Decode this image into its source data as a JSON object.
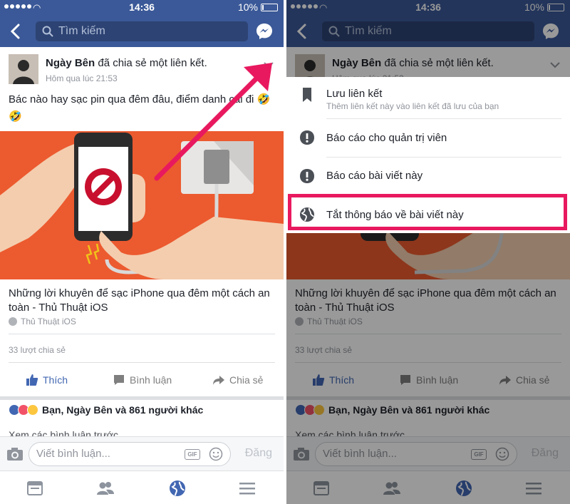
{
  "status": {
    "time": "14:36",
    "battery": "10%"
  },
  "search": {
    "placeholder": "Tìm kiếm"
  },
  "post": {
    "author": "Ngày Bên",
    "action": " đã chia sẻ một liên kết.",
    "time": "Hôm qua lúc 21:53",
    "text": "Bác nào hay sạc pin qua đêm đâu, điểm danh cái đi 🤣🤣",
    "link_title": "Những lời khuyên để sạc iPhone qua đêm một cách an toàn - Thủ Thuật iOS",
    "link_source": "Thủ Thuật iOS",
    "share_count": "33 lượt chia sẻ",
    "actions": {
      "like": "Thích",
      "comment": "Bình luận",
      "share": "Chia sẻ"
    },
    "reactions_text": "Bạn, Ngày Bên và 861 người khác",
    "previous_comments": "Xem các bình luận trước..."
  },
  "comment_bar": {
    "placeholder": "Viết bình luận...",
    "gif": "GIF",
    "post_label": "Đăng"
  },
  "menu": {
    "items": [
      {
        "label": "Lưu liên kết",
        "sub": "Thêm liên kết này vào liên kết đã lưu của bạn",
        "icon": "bookmark-icon"
      },
      {
        "label": "Báo cáo cho quản trị viên",
        "icon": "alert-icon"
      },
      {
        "label": "Báo cáo bài viết này",
        "icon": "alert-icon"
      },
      {
        "label": "Tắt thông báo về bài viết này",
        "icon": "globe-icon"
      }
    ]
  },
  "colors": {
    "brand": "#3b5998",
    "highlight": "#e8195f",
    "image_bg": "#ec5a2f"
  }
}
